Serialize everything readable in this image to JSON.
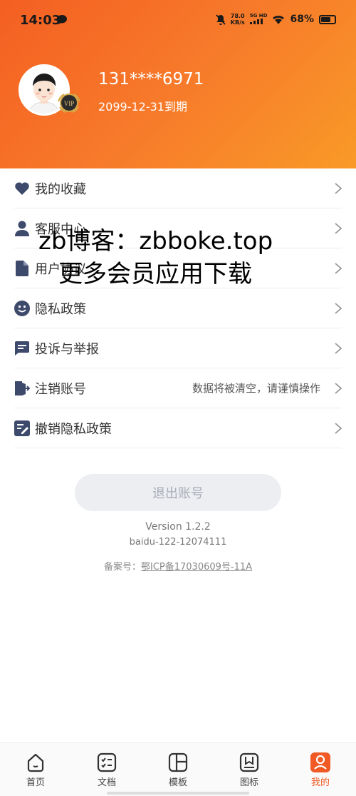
{
  "status_bar": {
    "time": "14:03",
    "net_speed_value": "78.0",
    "net_speed_unit": "KB/s",
    "network": "5G HD",
    "battery": "68%"
  },
  "profile": {
    "phone": "131****6971",
    "expire": "2099-12-31到期",
    "vip_badge": "VIP"
  },
  "menu": {
    "items": [
      {
        "label": "我的收藏",
        "icon": "heart-icon"
      },
      {
        "label": "客服中心",
        "icon": "person-icon"
      },
      {
        "label": "用户协议",
        "icon": "document-icon"
      },
      {
        "label": "隐私政策",
        "icon": "smile-icon"
      },
      {
        "label": "投诉与举报",
        "icon": "message-icon"
      },
      {
        "label": "注销账号",
        "icon": "exit-icon",
        "note": "数据将被清空，请谨慎操作"
      },
      {
        "label": "撤销隐私政策",
        "icon": "revoke-icon"
      }
    ]
  },
  "watermark": {
    "line1": "zb博客：zbboke.top",
    "line2": "更多会员应用下载"
  },
  "footer": {
    "logout": "退出账号",
    "version": "Version 1.2.2",
    "channel": "baidu-122-12074111",
    "icp_label": "备案号：",
    "icp_number": "鄂ICP备17030609号-11A"
  },
  "tabbar": {
    "tabs": [
      {
        "label": "首页",
        "icon": "home-icon"
      },
      {
        "label": "文档",
        "icon": "checklist-icon"
      },
      {
        "label": "模板",
        "icon": "template-icon"
      },
      {
        "label": "图标",
        "icon": "bookmark-icon"
      },
      {
        "label": "我的",
        "icon": "profile-icon",
        "active": true
      }
    ]
  },
  "colors": {
    "accent": "#f15a24",
    "icon": "#3d4a6b"
  }
}
